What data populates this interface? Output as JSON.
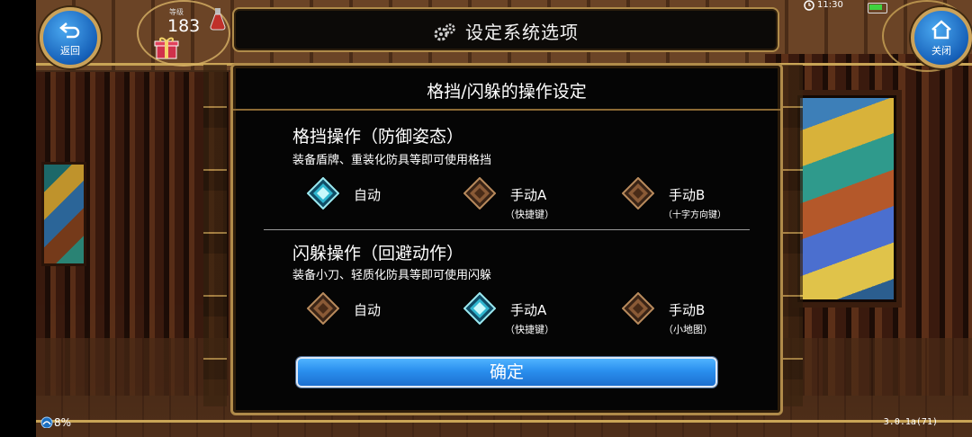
{
  "header": {
    "title": "设定系统选项",
    "back_label": "返回",
    "close_label": "关闭"
  },
  "player": {
    "level_label": "等级",
    "level_value": "183"
  },
  "status": {
    "time": "11:30",
    "battery_color": "#3fd23f"
  },
  "dialog": {
    "title": "格挡/闪躲的操作设定",
    "block": {
      "title": "格挡操作（防御姿态）",
      "desc": "装备盾牌、重装化防具等即可使用格挡",
      "options": [
        {
          "label": "自动",
          "sub": "",
          "selected": true
        },
        {
          "label": "手动A",
          "sub": "（快捷键）",
          "selected": false
        },
        {
          "label": "手动B",
          "sub": "（十字方向键）",
          "selected": false
        }
      ]
    },
    "dodge": {
      "title": "闪躲操作（回避动作）",
      "desc": "装备小刀、轻质化防具等即可使用闪躲",
      "options": [
        {
          "label": "自动",
          "sub": "",
          "selected": false
        },
        {
          "label": "手动A",
          "sub": "（快捷键）",
          "selected": true
        },
        {
          "label": "手动B",
          "sub": "（小地图）",
          "selected": false
        }
      ]
    },
    "confirm_label": "确定"
  },
  "footer": {
    "signal": "8%",
    "version": "3.0.1a(71)"
  },
  "colors": {
    "accent_gold": "#b08b4a",
    "button_blue": "#2a8fee",
    "selected_diamond": "#5fe3e8",
    "unselected_diamond": "#8a5a36"
  }
}
